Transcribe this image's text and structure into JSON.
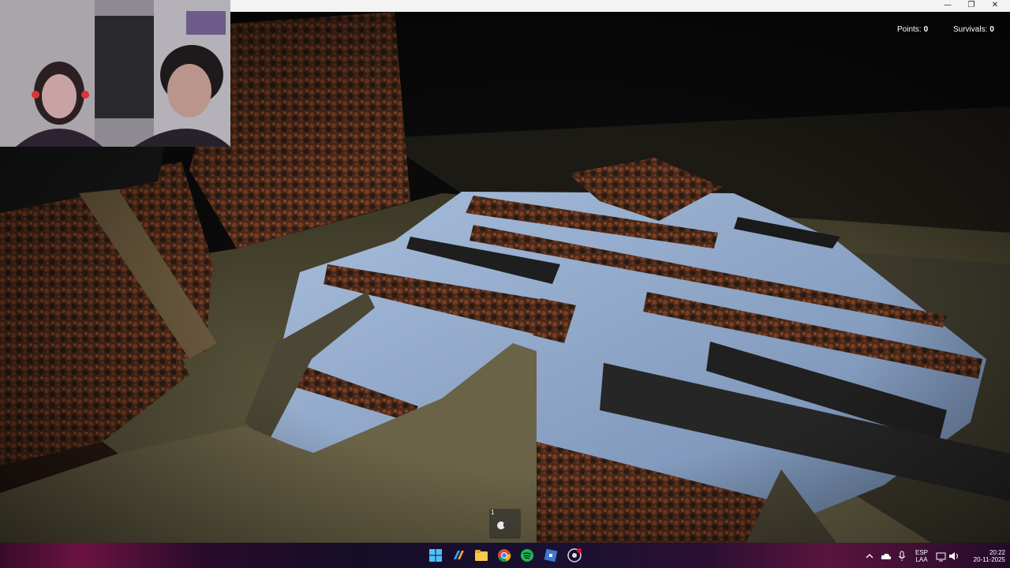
{
  "window": {
    "minimize": "—",
    "restore": "❐",
    "close": "✕"
  },
  "hud": {
    "points_label": "Points:",
    "points_value": "0",
    "survivals_label": "Survivals:",
    "survivals_value": "0"
  },
  "hotbar": {
    "slot_number": "1",
    "item_icon": "flashlight-icon"
  },
  "taskbar": {
    "icons": [
      "windows-start-icon",
      "copilot-icon",
      "file-explorer-icon",
      "chrome-icon",
      "spotify-icon",
      "roblox-icon",
      "obs-icon"
    ],
    "language_top": "ESP",
    "language_bottom": "LAA",
    "time": "20:22",
    "date": "20-11-2025"
  },
  "colors": {
    "water": "#8fa7c8",
    "rust": "#5a3320",
    "floor": "#6b6448",
    "taskbar_accent": "#6b1342"
  }
}
